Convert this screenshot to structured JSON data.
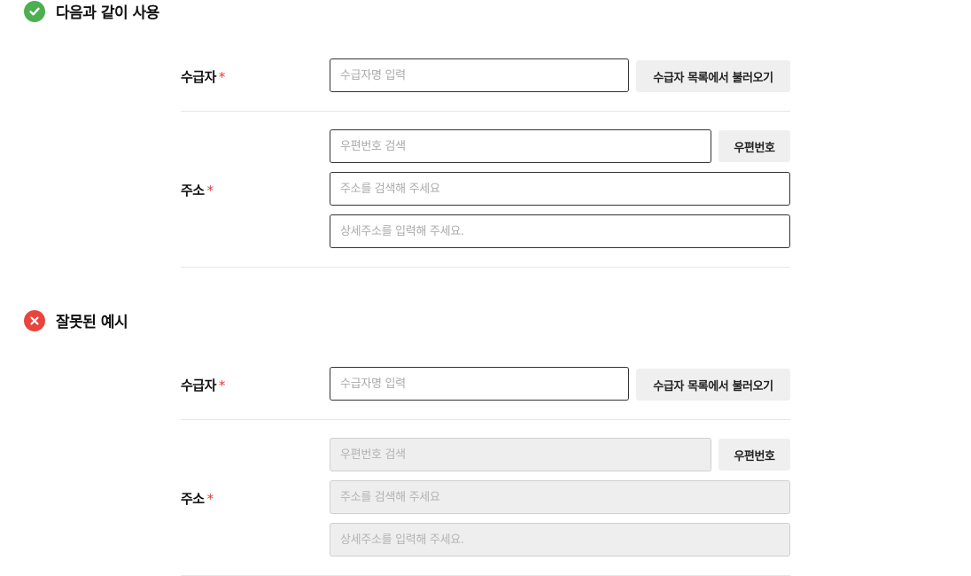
{
  "good_section": {
    "title": "다음과 같이 사용",
    "icon": "check-icon",
    "color": "#4caf50",
    "recipient": {
      "label": "수급자",
      "required_mark": "*",
      "placeholder": "수급자명 입력",
      "button": "수급자 목록에서 불러오기"
    },
    "address": {
      "label": "주소",
      "required_mark": "*",
      "postcode_placeholder": "우편번호 검색",
      "postcode_button": "우편번호",
      "address_placeholder": "주소를 검색해 주세요",
      "detail_placeholder": "상세주소를 입력해 주세요."
    }
  },
  "bad_section": {
    "title": "잘못된 예시",
    "icon": "x-icon",
    "color": "#e8453c",
    "recipient": {
      "label": "수급자",
      "required_mark": "*",
      "placeholder": "수급자명 입력",
      "button": "수급자 목록에서 불러오기"
    },
    "address": {
      "label": "주소",
      "required_mark": "*",
      "postcode_placeholder": "우편번호 검색",
      "postcode_button": "우편번호",
      "address_placeholder": "주소를 검색해 주세요",
      "detail_placeholder": "상세주소를 입력해 주세요."
    }
  }
}
